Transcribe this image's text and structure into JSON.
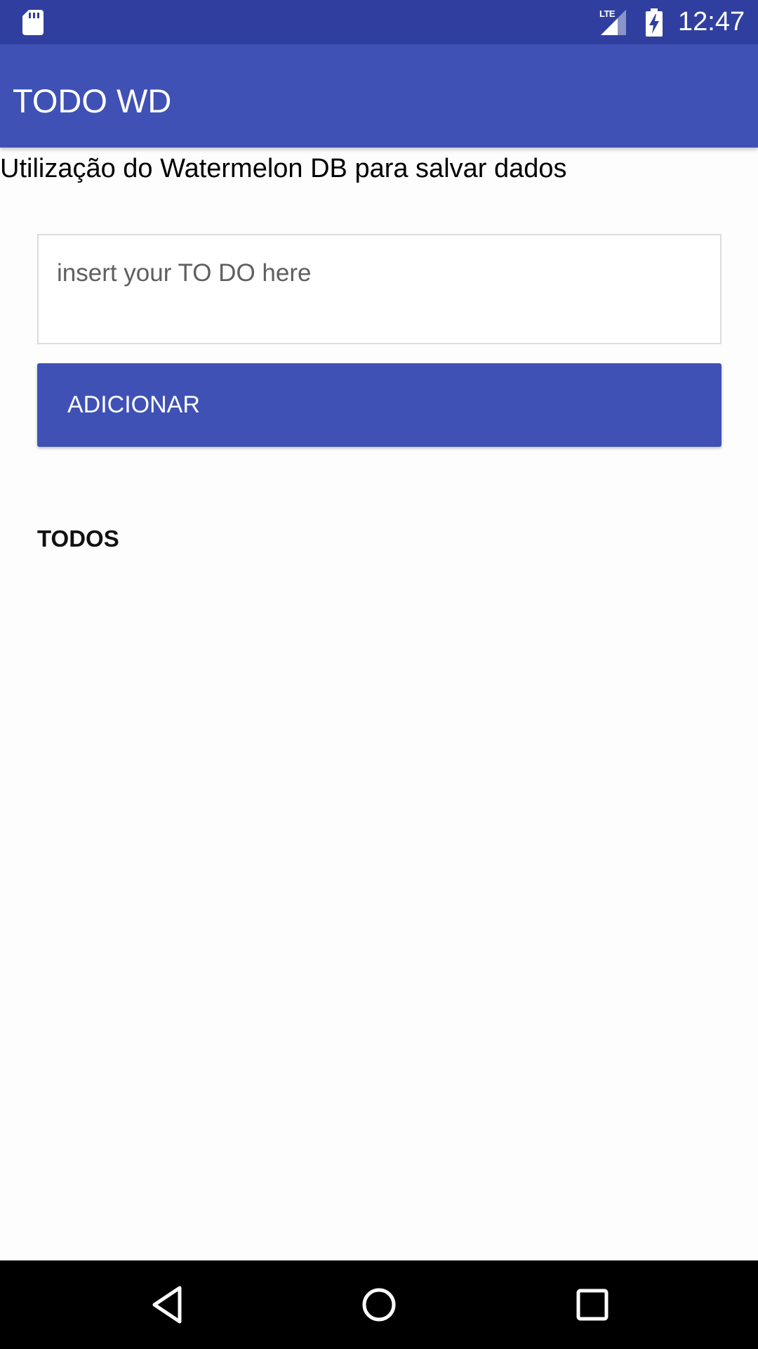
{
  "status_bar": {
    "time": "12:47",
    "network_type": "LTE",
    "icons": [
      "sd-card-icon",
      "lte-signal-icon",
      "battery-charging-icon"
    ]
  },
  "app_bar": {
    "title": "TODO WD",
    "color": "#3f51b5",
    "status_color": "#303f9f"
  },
  "main": {
    "subtitle": "Utilização do Watermelon DB para salvar dados",
    "input": {
      "value": "",
      "placeholder": "insert your TO DO here"
    },
    "add_button_label": "ADICIONAR",
    "list_heading": "TODOS",
    "todos": []
  },
  "nav_bar": {
    "buttons": [
      "back-icon",
      "home-icon",
      "recents-icon"
    ]
  }
}
